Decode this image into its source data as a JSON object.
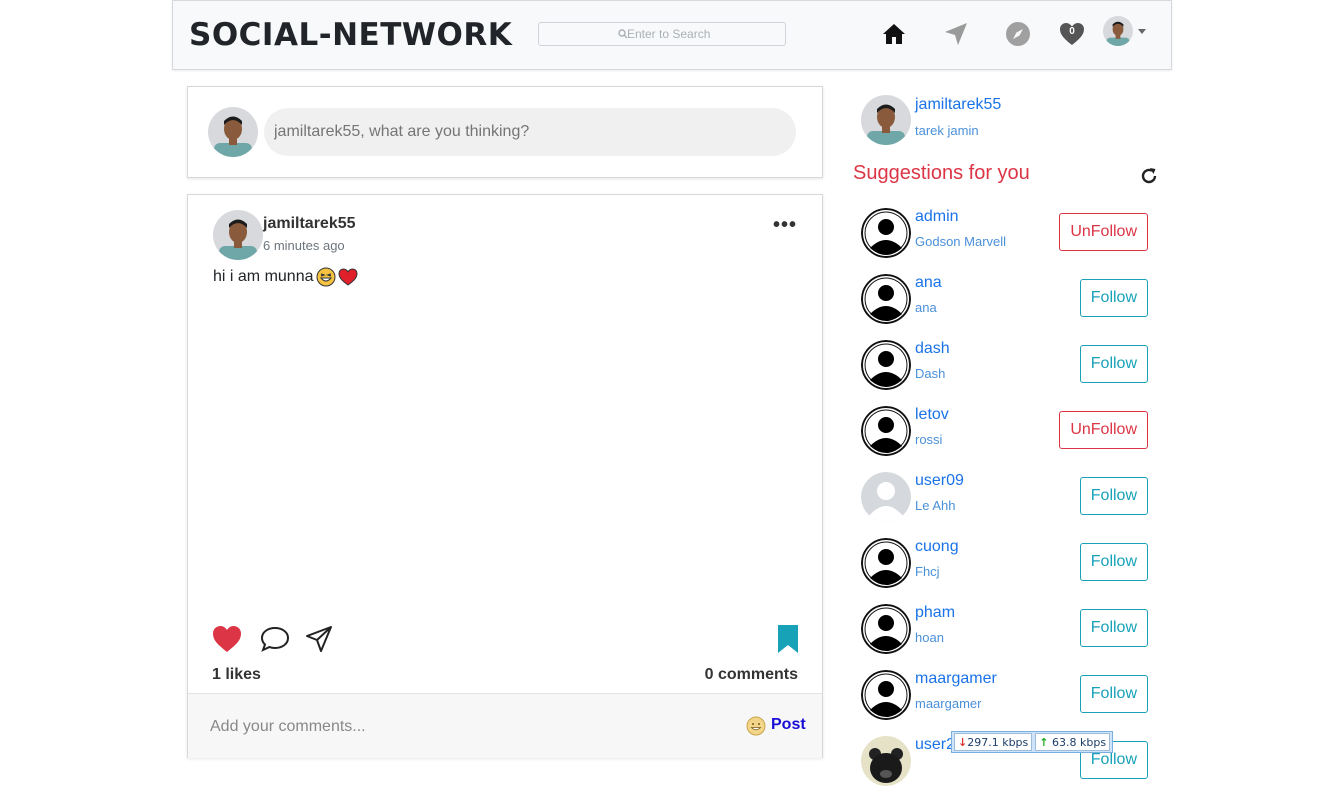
{
  "navbar": {
    "brand": "SOCIAL-NETWORK",
    "search_placeholder": "Enter to Search",
    "notifications_count": "0"
  },
  "create_post": {
    "placeholder": "jamiltarek55, what are you thinking?"
  },
  "post": {
    "username": "jamiltarek55",
    "time": "6 minutes ago",
    "text": "hi i am munna",
    "likes": "1 likes",
    "comments": "0 comments",
    "comment_placeholder": "Add your comments...",
    "post_label": "Post"
  },
  "sidebar": {
    "me": {
      "username": "jamiltarek55",
      "name": "tarek jamin"
    },
    "suggestions_title": "Suggestions for you",
    "suggestions": [
      {
        "username": "admin",
        "name": "Godson Marvell",
        "button": "UnFollow"
      },
      {
        "username": "ana",
        "name": "ana",
        "button": "Follow"
      },
      {
        "username": "dash",
        "name": "Dash",
        "button": "Follow"
      },
      {
        "username": "letov",
        "name": "rossi",
        "button": "UnFollow"
      },
      {
        "username": "user09",
        "name": "Le Ahh",
        "button": "Follow"
      },
      {
        "username": "cuong",
        "name": "Fhcj",
        "button": "Follow"
      },
      {
        "username": "pham",
        "name": "hoan",
        "button": "Follow"
      },
      {
        "username": "maargamer",
        "name": "maargamer",
        "button": "Follow"
      },
      {
        "username": "user2",
        "name": "",
        "button": "Follow"
      }
    ]
  },
  "netspeed": {
    "down": "297.1 kbps",
    "up": "63.8 kbps"
  },
  "colors": {
    "danger": "#dc3545",
    "info": "#17a2b8",
    "link": "#1a73e8"
  }
}
